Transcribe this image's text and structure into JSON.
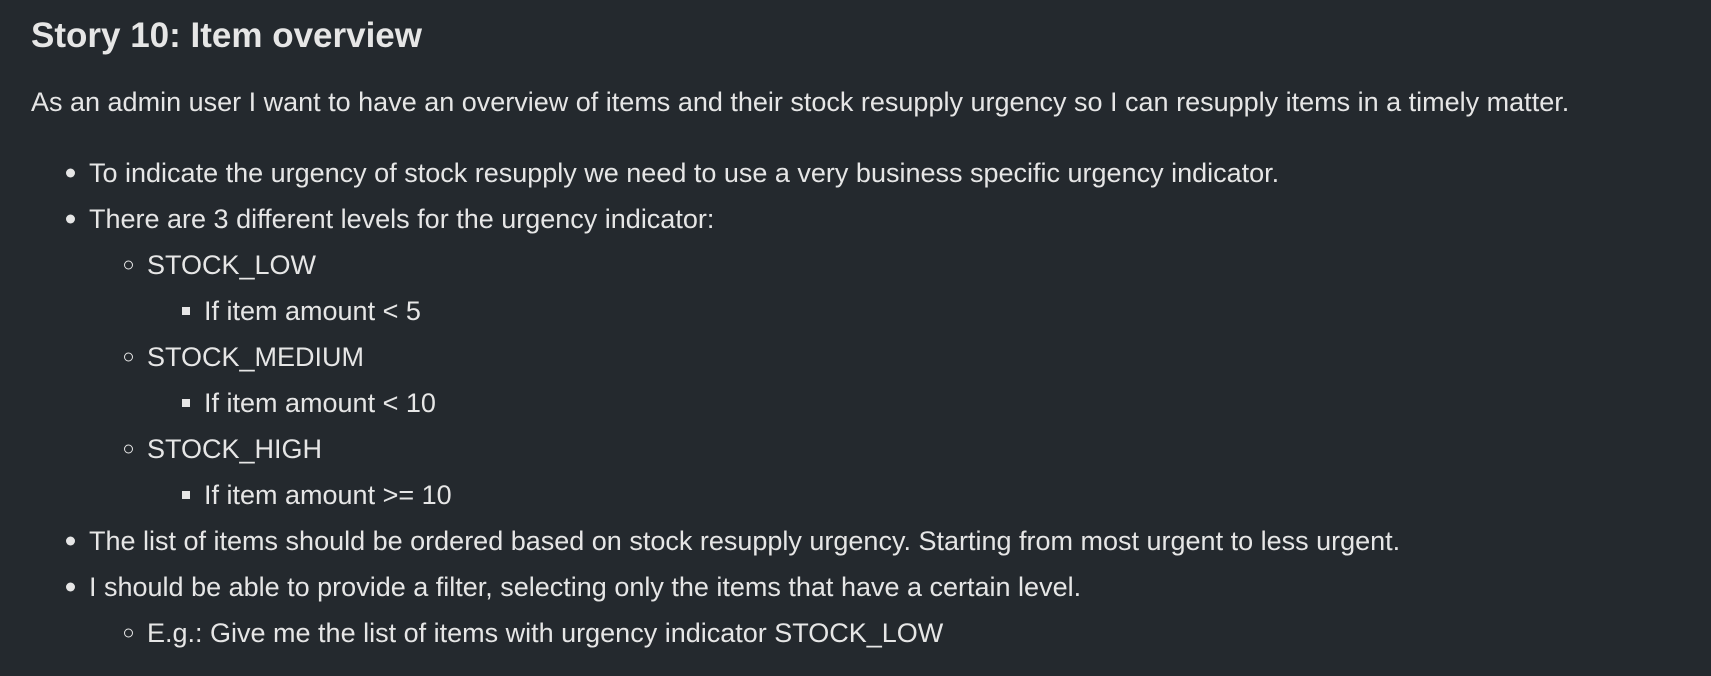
{
  "title": "Story 10: Item overview",
  "intro": "As an admin user I want to have an overview of items and their stock resupply urgency so I can resupply items in a timely matter.",
  "bullets": [
    "To indicate the urgency of stock resupply we need to use a very business specific urgency indicator.",
    "There are 3 different levels for the urgency indicator:",
    "The list of items should be ordered based on stock resupply urgency. Starting from most urgent to less urgent.",
    "I should be able to provide a filter, selecting only the items that have a certain level."
  ],
  "levels": [
    {
      "name": "STOCK_LOW",
      "rule": "If item amount < 5"
    },
    {
      "name": "STOCK_MEDIUM",
      "rule": "If item amount < 10"
    },
    {
      "name": "STOCK_HIGH",
      "rule": "If item amount >= 10"
    }
  ],
  "filter_example": "E.g.: Give me the list of items with urgency indicator STOCK_LOW"
}
